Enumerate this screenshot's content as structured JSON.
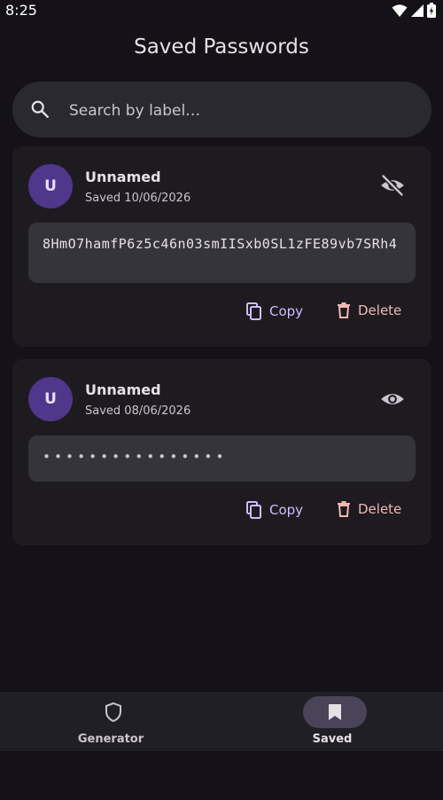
{
  "status_bar": {
    "time": "8:25"
  },
  "header": {
    "title": "Saved Passwords"
  },
  "search": {
    "placeholder": "Search by label…",
    "value": ""
  },
  "entries": [
    {
      "avatar": "U",
      "label": "Unnamed",
      "saved": "Saved 10/06/2026",
      "password": "8HmO7hamfP6z5c46n03smIISxb0SL1zFE89vb7SRh4",
      "visible": true,
      "visibility_icon": "visibility-off-icon",
      "copy_label": "Copy",
      "delete_label": "Delete"
    },
    {
      "avatar": "U",
      "label": "Unnamed",
      "saved": "Saved 08/06/2026",
      "password_masked": "••••••••••••••••",
      "visible": false,
      "visibility_icon": "visibility-icon",
      "copy_label": "Copy",
      "delete_label": "Delete"
    }
  ],
  "bottom_nav": {
    "items": [
      {
        "label": "Generator",
        "icon": "shield-icon",
        "active": false
      },
      {
        "label": "Saved",
        "icon": "bookmark-icon",
        "active": true
      }
    ]
  },
  "colors": {
    "background": "#141218",
    "surface": "#1D1B20",
    "accent": "#D0BCFF",
    "delete": "#F2B8B5",
    "avatar": "#4F378B"
  }
}
